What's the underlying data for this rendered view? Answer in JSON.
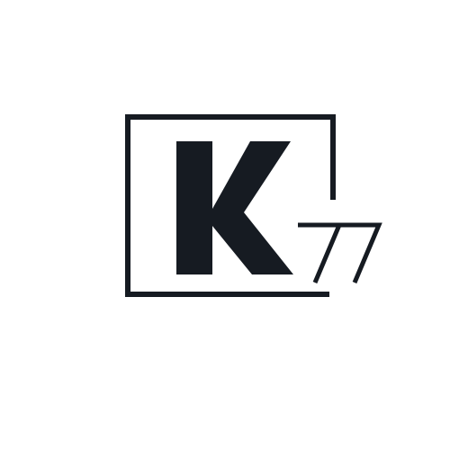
{
  "logo": {
    "letter": "K",
    "number": "77",
    "color": "#161b22",
    "background": "#ffffff"
  }
}
